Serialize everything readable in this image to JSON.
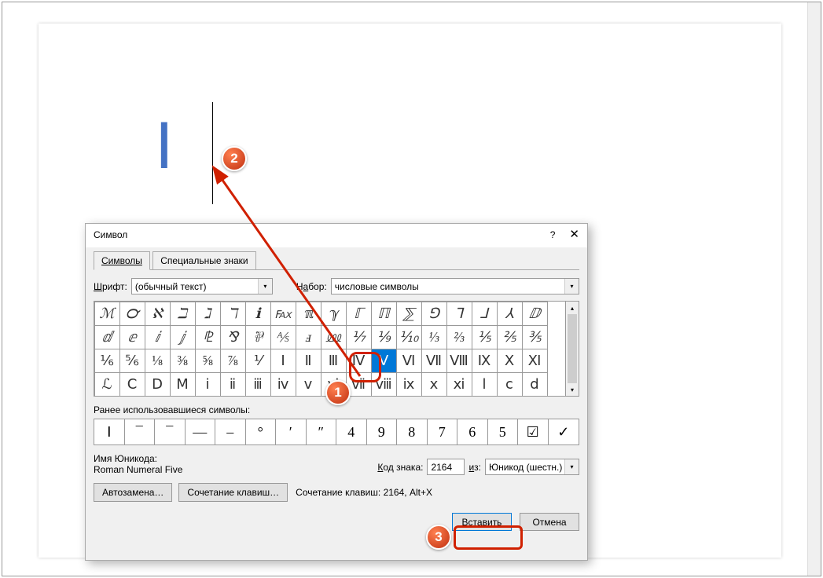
{
  "document": {
    "insertedChar": "Ⅰ"
  },
  "dialog": {
    "title": "Символ",
    "tabs": {
      "symbols": "Символы",
      "special": "Специальные знаки"
    },
    "fontLabel": "Шрифт:",
    "fontValue": "(обычный текст)",
    "setLabel": "Набор:",
    "setValue": "числовые символы",
    "grid": [
      [
        "ℳ",
        "℺",
        "ℵ",
        "ℶ",
        "ℷ",
        "ℸ",
        "ℹ",
        "℻",
        "ℼ",
        "ℽ",
        "ℾ",
        "ℿ",
        "⅀",
        "⅁",
        "⅂",
        "⅃",
        "⅄",
        "ⅅ"
      ],
      [
        "ⅆ",
        "ⅇ",
        "ⅈ",
        "ⅉ",
        "⅊",
        "⅋",
        "⅌",
        "⅍",
        "ⅎ",
        "⅏",
        "⅐",
        "⅑",
        "⅒",
        "⅓",
        "⅔",
        "⅕",
        "⅖",
        "⅗"
      ],
      [
        "⅙",
        "⅚",
        "⅛",
        "⅜",
        "⅝",
        "⅞",
        "⅟",
        "Ⅰ",
        "Ⅱ",
        "Ⅲ",
        "Ⅳ",
        "Ⅴ",
        "Ⅵ",
        "Ⅶ",
        "Ⅷ",
        "Ⅸ",
        "Ⅹ",
        "Ⅺ"
      ],
      [
        "ℒ",
        "Ⅽ",
        "Ⅾ",
        "Ⅿ",
        "ⅰ",
        "ⅱ",
        "ⅲ",
        "ⅳ",
        "ⅴ",
        "ⅵ",
        "ⅶ",
        "ⅷ",
        "ⅸ",
        "ⅹ",
        "ⅺ",
        "ⅼ",
        "ⅽ",
        "ⅾ"
      ]
    ],
    "selected": {
      "row": 2,
      "col": 11
    },
    "recentLabel": "Ранее использовавшиеся символы:",
    "recent": [
      "Ⅰ",
      "¯",
      "¯",
      "—",
      "–",
      "°",
      "′",
      "″",
      "4",
      "9",
      "8",
      "7",
      "6",
      "5",
      "☑",
      "✓"
    ],
    "recentExtra": [
      "☑",
      "✓"
    ],
    "unicodeLabel": "Имя Юникода:",
    "unicodeName": "Roman Numeral Five",
    "codeLabel": "Код знака:",
    "codeValue": "2164",
    "fromLabel": "из:",
    "fromValue": "Юникод (шестн.)",
    "autoCorrect": "Автозамена…",
    "shortcutKeys": "Сочетание клавиш…",
    "shortcutText": "Сочетание клавиш: 2164, Alt+X",
    "insert": "Вставить",
    "cancel": "Отмена"
  },
  "annotations": {
    "b1": "1",
    "b2": "2",
    "b3": "3"
  }
}
